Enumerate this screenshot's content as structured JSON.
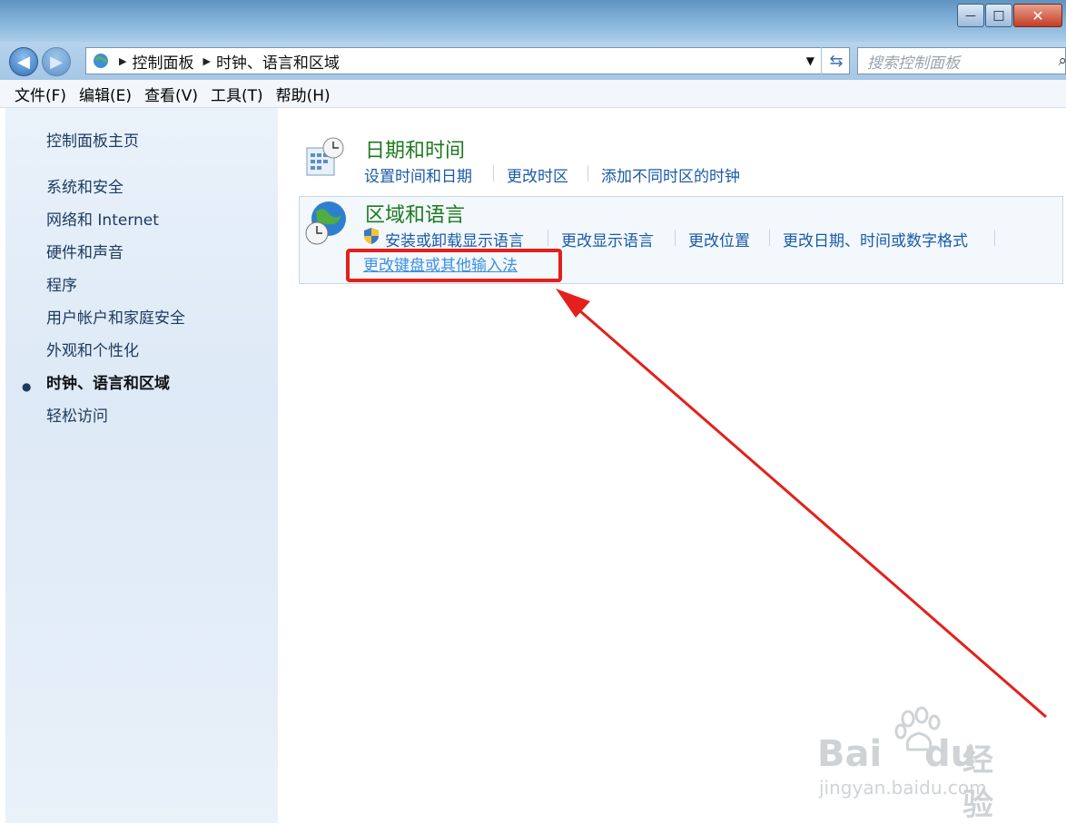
{
  "titlebar": {
    "minimize_glyph": "—",
    "maximize_glyph": "□",
    "close_glyph": "✕"
  },
  "address": {
    "root": "控制面板",
    "current": "时钟、语言和区域"
  },
  "search": {
    "placeholder": "搜索控制面板"
  },
  "menu": {
    "file": "文件(F)",
    "edit": "编辑(E)",
    "view": "查看(V)",
    "tools": "工具(T)",
    "help": "帮助(H)"
  },
  "sidebar": {
    "home": "控制面板主页",
    "items": [
      "系统和安全",
      "网络和 Internet",
      "硬件和声音",
      "程序",
      "用户帐户和家庭安全",
      "外观和个性化",
      "时钟、语言和区域",
      "轻松访问"
    ]
  },
  "datetime": {
    "title": "日期和时间",
    "links": [
      "设置时间和日期",
      "更改时区",
      "添加不同时区的时钟"
    ]
  },
  "region": {
    "title": "区域和语言",
    "links": [
      "安装或卸载显示语言",
      "更改显示语言",
      "更改位置",
      "更改日期、时间或数字格式",
      "更改键盘或其他输入法"
    ]
  },
  "watermark": {
    "brand": "Bai",
    "brand2": "du",
    "cn": "经验",
    "url": "jingyan.baidu.com"
  },
  "colors": {
    "annotation": "#e3201b",
    "link": "#1a5aa8",
    "category": "#1e7a1e"
  }
}
